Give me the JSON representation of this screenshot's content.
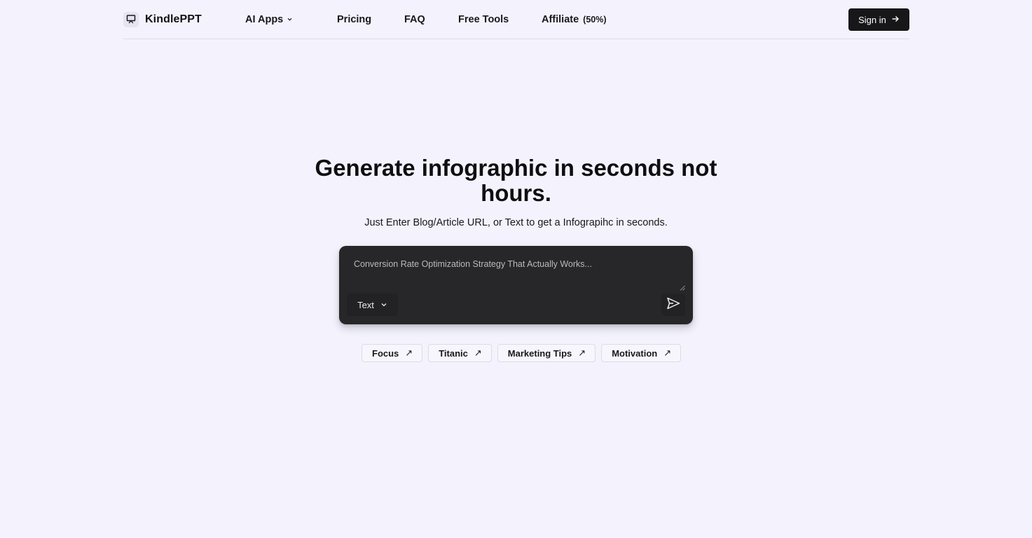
{
  "header": {
    "brand_name": "KindlePPT",
    "brand_icon": "presentation-icon",
    "nav": {
      "ai_apps": "AI Apps",
      "pricing": "Pricing",
      "faq": "FAQ",
      "free_tools": "Free Tools",
      "affiliate": "Affiliate",
      "affiliate_badge": "(50%)"
    },
    "sign_in": "Sign in"
  },
  "hero": {
    "title": "Generate infographic in seconds not hours.",
    "subtitle": "Just Enter Blog/Article URL, or Text to get a Infograpihc in seconds."
  },
  "input": {
    "placeholder": "Conversion Rate Optimization Strategy That Actually Works...",
    "value": "",
    "type_selected": "Text",
    "send_icon": "send-icon"
  },
  "suggestions": [
    {
      "label": "Focus",
      "icon": "arrow-up-right-icon"
    },
    {
      "label": "Titanic",
      "icon": "arrow-up-right-icon"
    },
    {
      "label": "Marketing Tips",
      "icon": "arrow-up-right-icon"
    },
    {
      "label": "Motivation",
      "icon": "arrow-up-right-icon"
    }
  ],
  "colors": {
    "background": "#f4f3fd",
    "input_bg": "#27272a",
    "button_dark": "#17171a",
    "text": "#111114"
  }
}
